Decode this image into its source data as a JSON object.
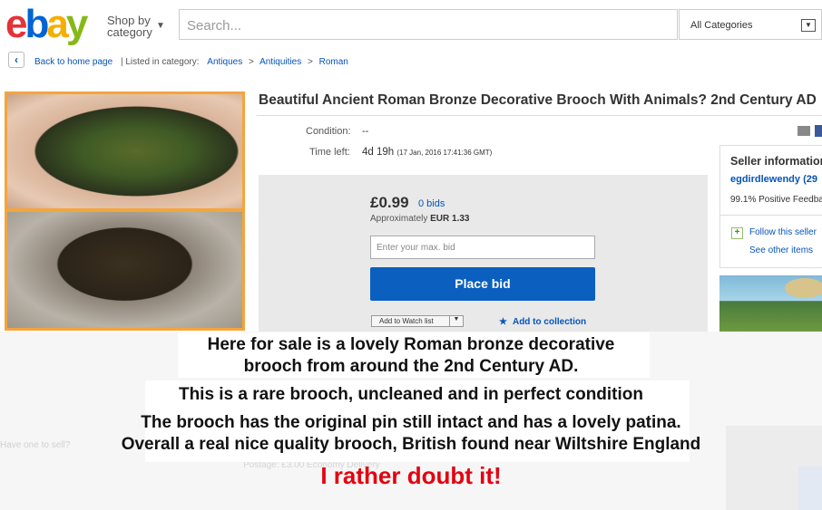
{
  "header": {
    "logo": {
      "e": "e",
      "b": "b",
      "a": "a",
      "y": "y"
    },
    "shop_by_line1": "Shop by",
    "shop_by_line2": "category",
    "search_placeholder": "Search...",
    "category_select": "All Categories"
  },
  "breadcrumb": {
    "back_label": "Back to home page",
    "listed_label": "| Listed in category:",
    "items": [
      "Antiques",
      "Antiquities",
      "Roman"
    ],
    "separator": ">"
  },
  "listing": {
    "title": "Beautiful Ancient Roman Bronze Decorative Brooch With Animals? 2nd Century AD",
    "condition_label": "Condition:",
    "condition_value": "--",
    "time_left_label": "Time left:",
    "time_left_value": "4d 19h",
    "time_left_detail": "(17 Jan, 2016   17:41:36 GMT)"
  },
  "bid": {
    "price": "£0.99",
    "bids": "0 bids",
    "approx_label": "Approximately",
    "approx_value": "EUR 1.33",
    "max_bid_placeholder": "Enter your max. bid",
    "place_bid_label": "Place bid",
    "watch_label": "Add to Watch list",
    "collection_label": "Add to collection"
  },
  "seller": {
    "heading": "Seller information",
    "name": "egdirdlewendy (29",
    "feedback": "99.1% Positive Feedback",
    "follow": "Follow this seller",
    "other_items": "See other items"
  },
  "ghost": {
    "line1": "Have one to sell?",
    "line2": "Postage:  £3.00 Economy Delivery"
  },
  "caption": {
    "line1": "Here for sale is a lovely Roman bronze decorative",
    "line2": "brooch from around the 2nd Century AD.",
    "line3": "This is a rare brooch, uncleaned and in perfect condition",
    "line4": "The brooch has the original pin still intact and has a lovely patina.",
    "line5": "Overall a real nice quality brooch, British found near Wiltshire England",
    "comment": "I rather doubt it!"
  },
  "colors": {
    "ebay_red": "#e53238",
    "ebay_blue": "#0064d2",
    "ebay_yellow": "#f5af02",
    "ebay_green": "#86b817",
    "link": "#0654ba",
    "button": "#0a5fbf",
    "photo_border": "#f4a53c",
    "comment": "#e4000f"
  },
  "icons": {
    "back": "chevron-left-icon",
    "caret": "chevron-down-icon",
    "star": "star-icon",
    "mail": "mail-icon",
    "facebook": "facebook-icon",
    "plus": "plus-icon"
  }
}
